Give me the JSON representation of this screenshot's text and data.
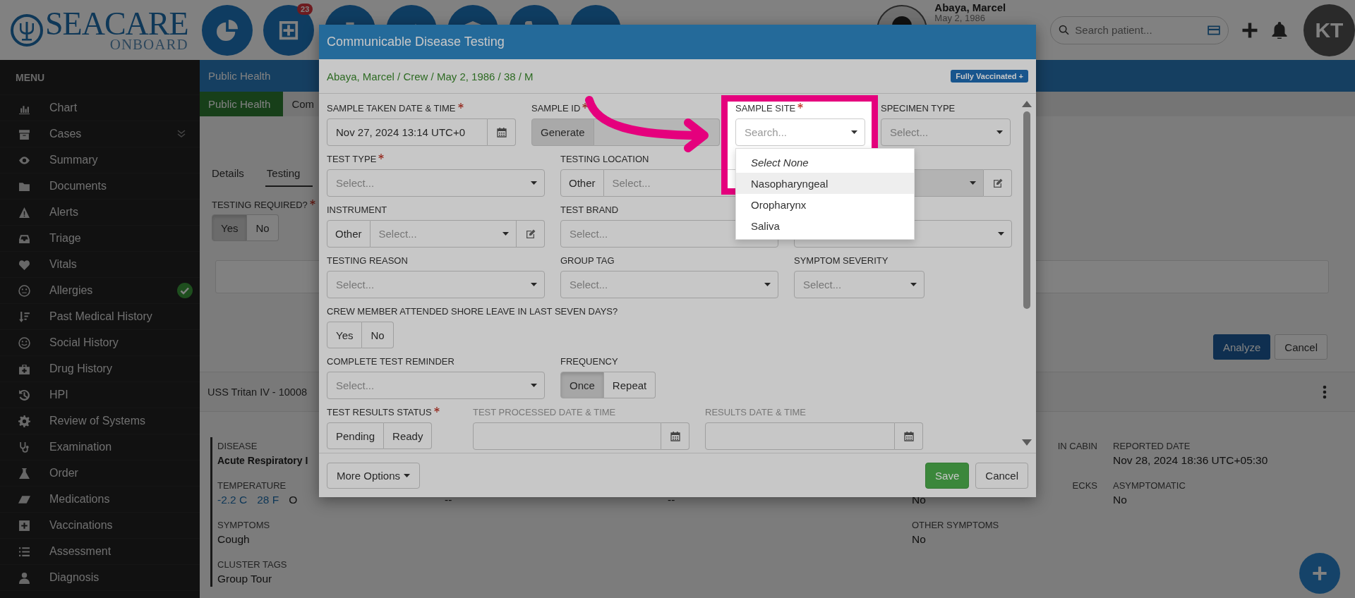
{
  "header": {
    "logo": {
      "name": "SEACARE",
      "tagline": "ONBOARD"
    },
    "nav_badge": "23",
    "patient": {
      "name": "Abaya, Marcel",
      "dob": "May 2, 1986"
    },
    "search": {
      "placeholder": "Search patient..."
    },
    "user_initials": "KT"
  },
  "sidebar": {
    "title": "MENU",
    "items": [
      {
        "label": "Chart",
        "kind": "link",
        "completed": false
      },
      {
        "label": "Cases",
        "kind": "group",
        "completed": false
      },
      {
        "label": "Summary",
        "kind": "link",
        "completed": false
      },
      {
        "label": "Documents",
        "kind": "link",
        "completed": false
      },
      {
        "label": "Alerts",
        "kind": "link",
        "completed": false
      },
      {
        "label": "Triage",
        "kind": "link",
        "completed": false
      },
      {
        "label": "Vitals",
        "kind": "link",
        "completed": false
      },
      {
        "label": "Allergies",
        "kind": "link",
        "completed": true
      },
      {
        "label": "Past Medical History",
        "kind": "link",
        "completed": false
      },
      {
        "label": "Social History",
        "kind": "link",
        "completed": false
      },
      {
        "label": "Drug History",
        "kind": "link",
        "completed": false
      },
      {
        "label": "HPI",
        "kind": "link",
        "completed": false
      },
      {
        "label": "Review of Systems",
        "kind": "link",
        "completed": false
      },
      {
        "label": "Examination",
        "kind": "link",
        "completed": false
      },
      {
        "label": "Order",
        "kind": "link",
        "completed": false
      },
      {
        "label": "Medications",
        "kind": "link",
        "completed": false
      },
      {
        "label": "Vaccinations",
        "kind": "link",
        "completed": false
      },
      {
        "label": "Assessment",
        "kind": "link",
        "completed": false
      },
      {
        "label": "Diagnosis",
        "kind": "link",
        "completed": false
      }
    ]
  },
  "page_title": "Public Health",
  "module_tabs": [
    {
      "label": "Public Health",
      "selected": true
    },
    {
      "label": "Com",
      "selected": false
    }
  ],
  "sub_tabs": [
    {
      "label": "Details",
      "selected": false
    },
    {
      "label": "Testing",
      "selected": true
    }
  ],
  "testing_required": {
    "label": "TESTING REQUIRED?",
    "required": true,
    "options": [
      {
        "label": "Yes",
        "selected": true
      },
      {
        "label": "No",
        "selected": false
      }
    ]
  },
  "actions": [
    {
      "label": "Analyze",
      "kind": "primary"
    },
    {
      "label": "Cancel",
      "kind": "default"
    }
  ],
  "case_header": "USS Tritan IV - 10008",
  "case_details": [
    [
      {
        "kind": "title",
        "label": "DISEASE",
        "value": "Acute Respiratory I"
      },
      {
        "kind": "empty"
      },
      {
        "kind": "empty"
      },
      {
        "kind": "clipped",
        "label": "IN CABIN"
      },
      {
        "kind": "text",
        "label": "REPORTED DATE",
        "value": "Nov 28, 2024 18:36 UTC+05:30"
      }
    ],
    [
      {
        "kind": "temperature",
        "label": "TEMPERATURE",
        "values": [
          {
            "text": "-2.2 C",
            "link": true
          },
          {
            "text": "28 F",
            "link": true
          },
          {
            "text": "O",
            "link": false
          }
        ]
      },
      {
        "kind": "text",
        "value": "--"
      },
      {
        "kind": "text",
        "value": "--"
      },
      {
        "kind": "clipped",
        "label": "ECKS",
        "value": "No"
      },
      {
        "kind": "text",
        "label": "ASYMPTOMATIC",
        "value": "No"
      }
    ],
    [
      {
        "kind": "text",
        "label": "SYMPTOMS",
        "value": "Cough"
      },
      {
        "kind": "empty"
      },
      {
        "kind": "empty"
      },
      {
        "kind": "text",
        "label": "OTHER SYMPTOMS",
        "value": "No"
      },
      {
        "kind": "empty"
      }
    ],
    [
      {
        "kind": "text",
        "label": "CLUSTER TAGS",
        "value": "Group Tour"
      }
    ]
  ],
  "modal": {
    "title": "Communicable Disease Testing",
    "patient_line": "Abaya, Marcel / Crew / May 2, 1986 / 38 / M",
    "badge": "Fully Vaccinated +",
    "rows": [
      [
        {
          "kind": "datetime",
          "label": "SAMPLE TAKEN DATE & TIME",
          "required": true,
          "value": "Nov 27, 2024 13:14 UTC+0",
          "disabled": false
        },
        {
          "kind": "generate",
          "label": "SAMPLE ID",
          "required": true,
          "button": "Generate"
        },
        {
          "kind": "select",
          "label": "SAMPLE SITE",
          "required": true,
          "placeholder": "Search...",
          "edit": false,
          "disabled": false,
          "options": [
            {
              "label": "Select None",
              "kind": "none",
              "highlighted": false
            },
            {
              "label": "Nasopharyngeal",
              "kind": "option",
              "highlighted": true
            },
            {
              "label": "Oropharynx",
              "kind": "option",
              "highlighted": false
            },
            {
              "label": "Saliva",
              "kind": "option",
              "highlighted": false
            }
          ]
        },
        {
          "kind": "select",
          "label": "SPECIMEN TYPE",
          "required": false,
          "placeholder": "Select...",
          "edit": false,
          "disabled": false
        }
      ],
      [
        {
          "kind": "select",
          "label": "TEST TYPE",
          "required": true,
          "placeholder": "Select...",
          "edit": false,
          "disabled": false
        },
        {
          "kind": "select",
          "label": "TESTING LOCATION",
          "required": false,
          "other": "Other",
          "placeholder": "Select...",
          "edit": false,
          "disabled": false
        },
        {
          "kind": "select",
          "edit": true,
          "disabled": true
        }
      ],
      [
        {
          "kind": "select",
          "label": "INSTRUMENT",
          "required": false,
          "other": "Other",
          "placeholder": "Select...",
          "edit": true,
          "disabled": false
        },
        {
          "kind": "select",
          "label": "TEST BRAND",
          "required": false,
          "placeholder": "Select...",
          "edit": false,
          "disabled": false
        },
        {
          "kind": "select",
          "edit": false,
          "disabled": false
        }
      ],
      [
        {
          "kind": "select",
          "label": "TESTING REASON",
          "required": false,
          "placeholder": "Select...",
          "edit": false,
          "disabled": false
        },
        {
          "kind": "select",
          "label": "GROUP TAG",
          "required": false,
          "placeholder": "Select...",
          "edit": false,
          "disabled": false
        },
        {
          "kind": "select",
          "label": "SYMPTOM SEVERITY",
          "required": false,
          "placeholder": "Select...",
          "edit": false,
          "disabled": false
        }
      ],
      [
        {
          "kind": "toggle",
          "label": "CREW MEMBER ATTENDED SHORE LEAVE IN LAST SEVEN DAYS?",
          "required": false,
          "options": [
            {
              "label": "Yes",
              "selected": false
            },
            {
              "label": "No",
              "selected": false
            }
          ]
        }
      ],
      [
        {
          "kind": "select",
          "label": "COMPLETE TEST REMINDER",
          "required": false,
          "placeholder": "Select...",
          "edit": false,
          "disabled": false
        },
        {
          "kind": "toggle",
          "label": "FREQUENCY",
          "required": false,
          "options": [
            {
              "label": "Once",
              "selected": true
            },
            {
              "label": "Repeat",
              "selected": false
            }
          ]
        }
      ],
      [
        {
          "kind": "toggle",
          "label": "TEST RESULTS STATUS",
          "required": true,
          "options": [
            {
              "label": "Pending",
              "selected": false
            },
            {
              "label": "Ready",
              "selected": false
            }
          ]
        },
        {
          "kind": "datetime",
          "label": "TEST PROCESSED DATE & TIME",
          "required": false,
          "disabled": true
        },
        {
          "kind": "datetime",
          "label": "RESULTS DATE & TIME",
          "required": false,
          "disabled": true
        }
      ]
    ],
    "footer": {
      "more": "More Options",
      "save": "Save",
      "cancel": "Cancel"
    }
  }
}
